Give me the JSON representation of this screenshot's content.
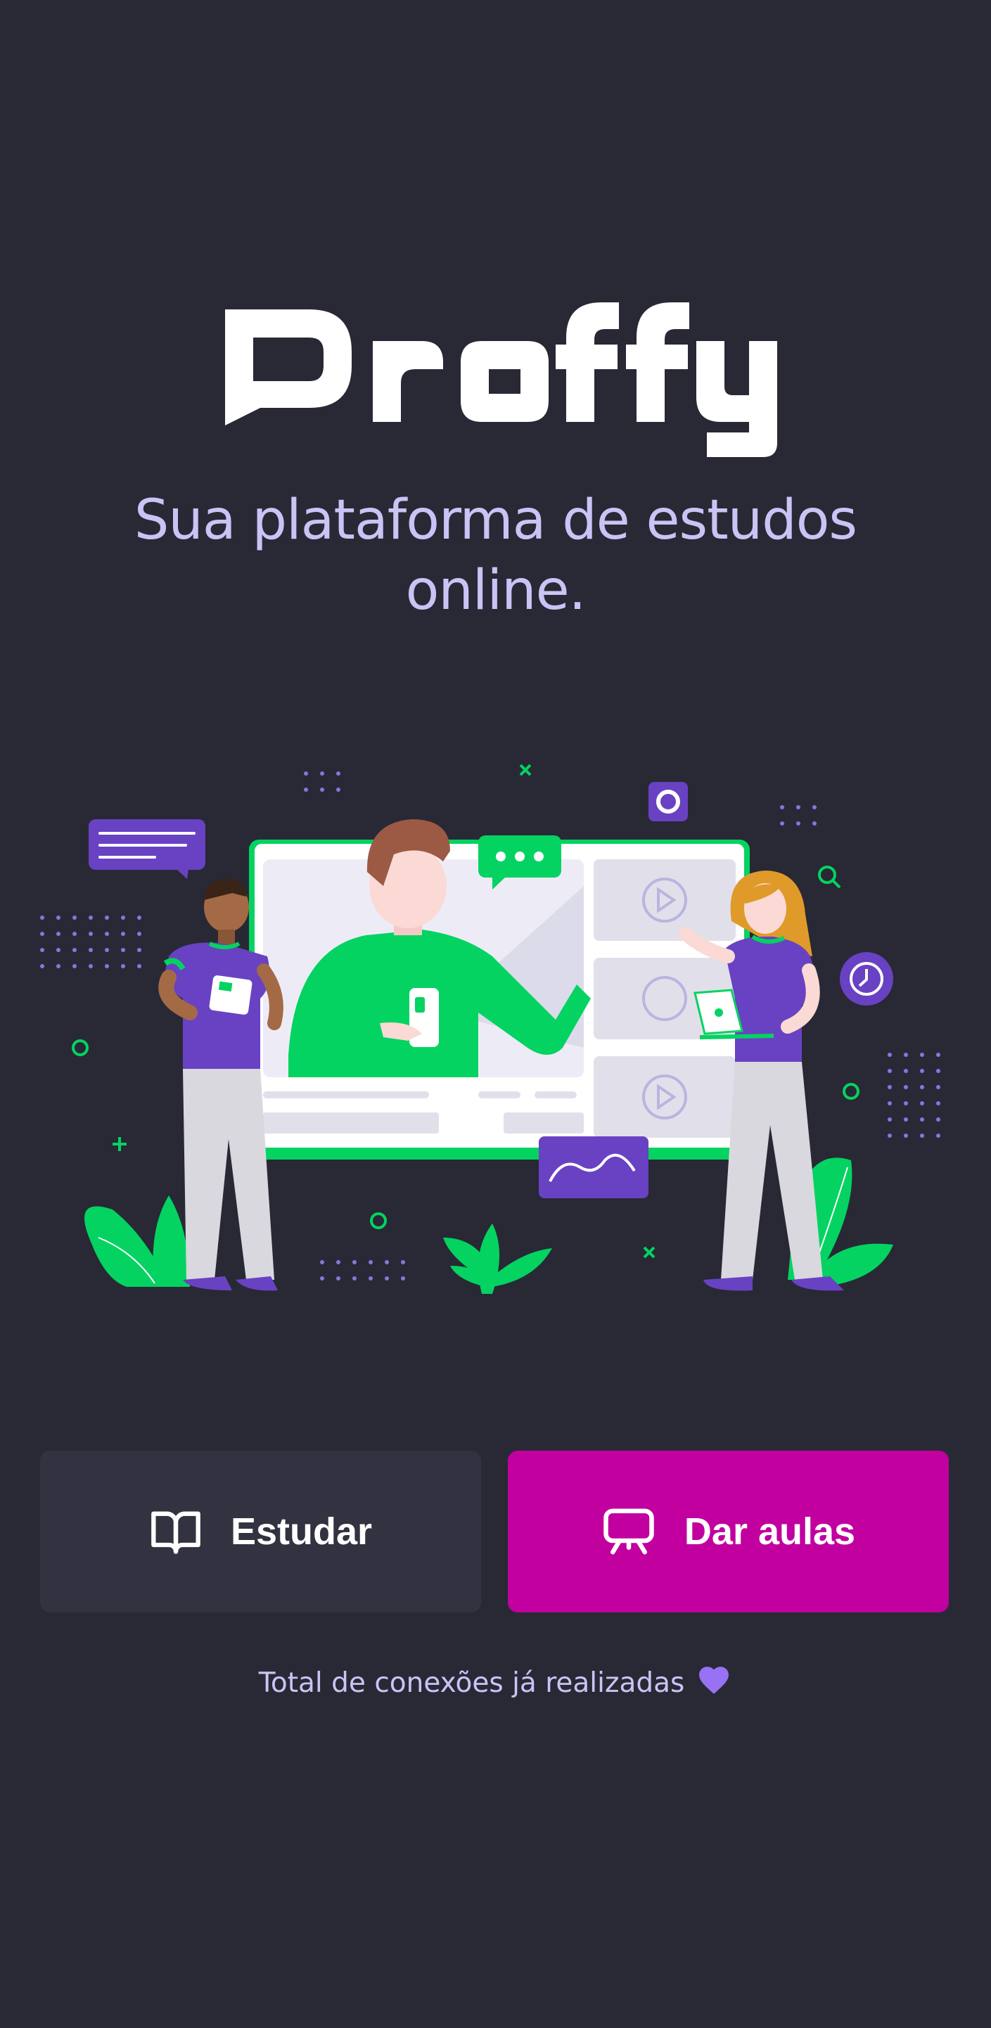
{
  "logo": {
    "text": "Proffy"
  },
  "tagline": "Sua plataforma de estudos online.",
  "hero": {
    "illustration": "people-online-class-illustration"
  },
  "actions": {
    "study_label": "Estudar",
    "study_icon": "book-open-icon",
    "teach_label": "Dar aulas",
    "teach_icon": "presentation-board-icon"
  },
  "connections": {
    "text": "Total de conexões já realizadas",
    "icon": "purple-heart-icon"
  },
  "colors": {
    "background": "#282935",
    "tagline": "#C9C4F5",
    "study_button": "#323240",
    "teach_button": "#C1009F",
    "accent_green": "#04D361",
    "accent_purple": "#6842C2"
  }
}
